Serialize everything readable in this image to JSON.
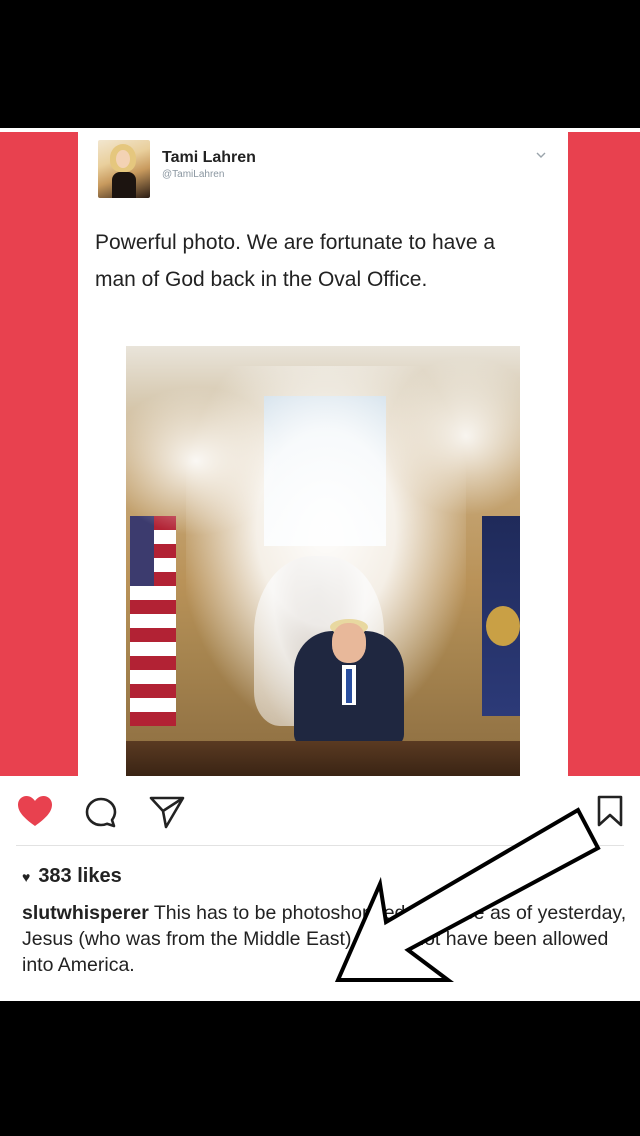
{
  "tweet": {
    "name": "Tami Lahren",
    "handle": "@TamiLahren",
    "text": "Powerful photo. We are fortunate to have a man of God back in the Oval Office."
  },
  "post": {
    "likes": "383 likes",
    "caption_user": "slutwhisperer",
    "caption_text": " This has to be photoshopped because as of yesterday, Jesus (who was from the Middle East) would not have been allowed into America."
  },
  "icons": {
    "like": "heart-icon",
    "comment": "comment-icon",
    "share": "share-icon",
    "save": "bookmark-icon",
    "caret": "chevron-down-icon"
  },
  "colors": {
    "accent_red": "#e8414f",
    "heart_red": "#e8414f"
  }
}
